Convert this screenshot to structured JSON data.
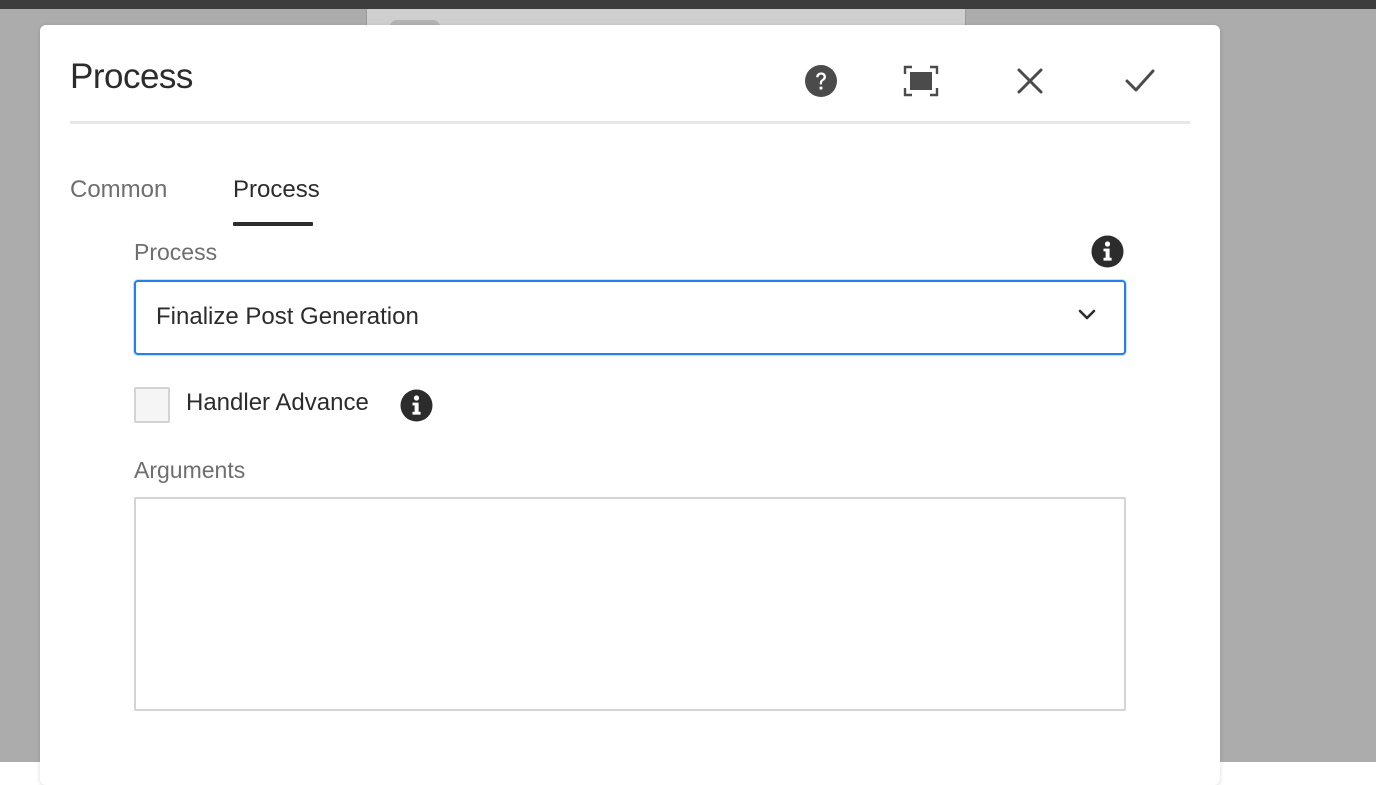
{
  "dialog": {
    "title": "Process",
    "header_actions": [
      {
        "name": "help-icon",
        "label": "Help"
      },
      {
        "name": "fullscreen-icon",
        "label": "Toggle fullscreen"
      },
      {
        "name": "close-icon",
        "label": "Cancel"
      },
      {
        "name": "checkmark-icon",
        "label": "Done"
      }
    ]
  },
  "tabs": [
    {
      "label": "Common",
      "selected": false
    },
    {
      "label": "Process",
      "selected": true
    }
  ],
  "form": {
    "process_label": "Process",
    "process_value": "Finalize Post Generation",
    "handler_advance_label": "Handler Advance",
    "handler_advance_checked": false,
    "arguments_label": "Arguments",
    "arguments_value": ""
  },
  "colors": {
    "accent": "#2680eb",
    "text": "#2c2c2c",
    "label": "#6e6e6e",
    "backdrop": "#acacac",
    "icon": "#4b4b4b"
  }
}
